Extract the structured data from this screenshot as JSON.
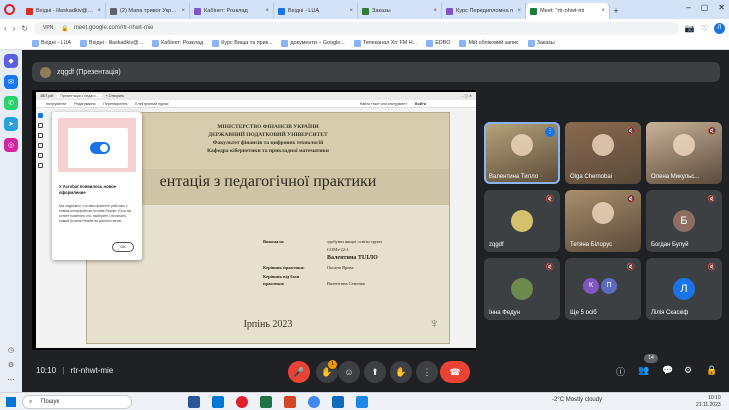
{
  "browser": {
    "tabs": [
      {
        "label": "Вхідні - lilaskadkiv@gma",
        "color": "#d93025"
      },
      {
        "label": "(2) Мапа тривог України",
        "color": "#5f6368"
      },
      {
        "label": "Кабінет: Розклад",
        "color": "#7e57c2"
      },
      {
        "label": "Вхідні - LUA",
        "color": "#1a73e8"
      },
      {
        "label": "Заказы",
        "color": "#2e7d32"
      },
      {
        "label": "Курс Передипломна п",
        "color": "#7e57c2"
      },
      {
        "label": "Meet: \"rtr-nhwt-mi",
        "color": "#188038",
        "active": true
      }
    ],
    "url": "meet.google.com/rtr-nhwt-mie",
    "vpn": "VPN",
    "profile": "Л",
    "bookmarks": [
      "Вхідні - LUA",
      "Вхідні - lilaskadkiv@...",
      "Кабінет: Розклад",
      "Курс Вища та прик...",
      "документи – Google...",
      "Телеканал Хіт FM Н...",
      "EDBO",
      "Мій обліковий запис",
      "Заказы"
    ]
  },
  "meet": {
    "presenter": "zqgdf (Презентація)",
    "meeting_code": "rtr-nhwt-mie",
    "time": "10:10",
    "people_count": "14",
    "chat_badge": "1"
  },
  "ppt": {
    "tab1": "3BIT.pdf",
    "tab2": "Презентація з педаго...",
    "tab3": "+ Створить",
    "menu": [
      "Інструменти",
      "Редагування",
      "Перетворення",
      "Електронний підпис"
    ],
    "search": "Найти текст или инструмент",
    "signin": "Войти",
    "slide": {
      "head1": "МІНІСТЕРСТВО ФІНАНСІВ УКРАЇНИ",
      "head2": "ДЕРЖАВНИЙ ПОДАТКОВИЙ УНІВЕРСИТЕТ",
      "head3": "Факультет фінансів та цифрових технологій",
      "head4": "Кафедра кібернетики та прикладної математики",
      "title": "ентація з педагогічної практики",
      "done_label": "Виконала:",
      "done_value": "здобувач вищої освіти групи",
      "group": "СОМз-22-1",
      "student": "Валентина ТІЛЛО",
      "lead_label": "Керівник практики:",
      "lead_value": "Оксана Ярова",
      "base_label": "Керівник від бази",
      "base_label2": "практики:",
      "base_value": "Валентина Семенко",
      "city_year": "Ірпінь 2023"
    },
    "popup": {
      "title": "У Acrobat появилось новое оформление",
      "text": "Мы надеемся, что вам нравится работать с новым интерфейсом Acrobat Reader. Если вы хотите поменять его, выберите Отключить новый Acrobat Reader во данного меню.",
      "ok": "ОК"
    }
  },
  "participants": [
    {
      "name": "Валентина Тилло",
      "kind": "photo",
      "bg": "#b7a57a",
      "speaking": true
    },
    {
      "name": "Olga Chernobai",
      "kind": "photo",
      "bg": "#8a6a4f"
    },
    {
      "name": "Олена Микульс...",
      "kind": "photo",
      "bg": "#c9b39a"
    },
    {
      "name": "zqgdf",
      "kind": "avatar",
      "bg": "#d4c16d",
      "letter": ""
    },
    {
      "name": "Тетяна Білорус",
      "kind": "photo",
      "bg": "#a88f6c"
    },
    {
      "name": "Богдан Булуй",
      "kind": "avatar",
      "bg": "#8d6e63",
      "letter": "Б"
    },
    {
      "name": "Інна Федун",
      "kind": "avatar",
      "bg": "#6e8b4f",
      "letter": ""
    },
    {
      "name": "Ще 5 осіб",
      "kind": "more",
      "bg": "#3c4043",
      "letter": "К П"
    },
    {
      "name": "Лілія Скаскіф",
      "kind": "avatar",
      "bg": "#1a73e8",
      "letter": "Л"
    }
  ],
  "taskbar": {
    "search": "Пошук",
    "weather": "-2°C Mostly cloudy",
    "time": "10:10",
    "date": "21.11.2023"
  }
}
